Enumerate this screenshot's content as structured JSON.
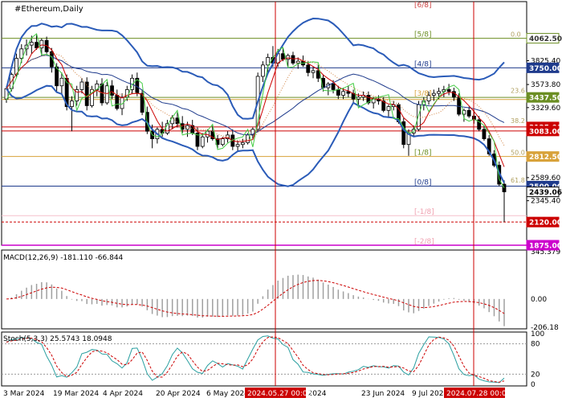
{
  "chart_data": {
    "type": "candlestick",
    "title": "#Ethereum,Daily",
    "price_axis": {
      "ticks": [
        "3825.40",
        "3573.80",
        "3329.60",
        "2589.60",
        "2345.40"
      ],
      "ylim": [
        1875,
        4450
      ]
    },
    "price_boxes": [
      {
        "label": "4062.50",
        "value": 4062.5,
        "bg": "#ffffff",
        "fg": "#333333",
        "border": "#6b8e23"
      },
      {
        "label": "3750.00",
        "value": 3750,
        "bg": "#1f3b8c",
        "fg": "#ffffff"
      },
      {
        "label": "3437.50",
        "value": 3437.5,
        "bg": "#6b8e23",
        "fg": "#ffffff"
      },
      {
        "label": "3125.00",
        "value": 3125,
        "bg": "#cc0000",
        "fg": "#ffffff"
      },
      {
        "label": "3083.00",
        "value": 3083,
        "bg": "#cc0000",
        "fg": "#ffffff"
      },
      {
        "label": "2812.50",
        "value": 2812.5,
        "bg": "#d8a23a",
        "fg": "#ffffff"
      },
      {
        "label": "2500.00",
        "value": 2500,
        "bg": "#1f3b8c",
        "fg": "#ffffff"
      },
      {
        "label": "2439.06",
        "value": 2439.06,
        "bg": "#ffffff",
        "fg": "#000000",
        "border": "#000000"
      },
      {
        "label": "2120.00",
        "value": 2120,
        "bg": "#cc0000",
        "fg": "#ffffff"
      },
      {
        "label": "1875.00",
        "value": 1875,
        "bg": "#cc00cc",
        "fg": "#ffffff"
      }
    ],
    "murrey_labels": [
      {
        "label": "[5/8]",
        "value": 4062.5,
        "color": "#6b8e23"
      },
      {
        "label": "[4/8]",
        "value": 3750,
        "color": "#1f3b8c"
      },
      {
        "label": "[3/8]",
        "value": 3437.5,
        "color": "#d8a23a"
      },
      {
        "label": "[1/8]",
        "value": 2812.5,
        "color": "#6b8e23"
      },
      {
        "label": "[0/8]",
        "value": 2500,
        "color": "#1f3b8c"
      },
      {
        "label": "[-1/8]",
        "value": 2187.5,
        "color": "#f0a0b0"
      },
      {
        "label": "[-2/8]",
        "value": 1875,
        "color": "#f0a0b0"
      },
      {
        "label": "[6/8]",
        "value": 4375,
        "color": "#cc4444"
      }
    ],
    "fib_labels": [
      {
        "label": "0.0",
        "value": 4062.5
      },
      {
        "label": "23.6",
        "value": 3470
      },
      {
        "label": "50.0",
        "value": 2812.5
      },
      {
        "label": "61.8",
        "value": 2520
      },
      {
        "label": "38.2",
        "value": 3150
      }
    ],
    "price_levels": [
      {
        "value": 4062.5,
        "color": "#6b8e23",
        "style": "solid"
      },
      {
        "value": 3750,
        "color": "#1f3b8c",
        "style": "solid"
      },
      {
        "value": 3437.5,
        "color": "#6b8e23",
        "style": "solid"
      },
      {
        "value": 3415,
        "color": "#d8a23a",
        "style": "solid"
      },
      {
        "value": 3125,
        "color": "#cc0000",
        "style": "solid"
      },
      {
        "value": 3083,
        "color": "#cc0000",
        "style": "solid"
      },
      {
        "value": 2812.5,
        "color": "#d8a23a",
        "style": "solid"
      },
      {
        "value": 2500,
        "color": "#1f3b8c",
        "style": "solid"
      },
      {
        "value": 2187.5,
        "color": "#f5c0cc",
        "style": "solid"
      },
      {
        "value": 2120,
        "color": "#cc0000",
        "style": "dashed"
      },
      {
        "value": 1875,
        "color": "#cc00cc",
        "style": "solid"
      }
    ],
    "x_labels": [
      "3 Mar 2024",
      "19 Mar 2024",
      "4 Apr 2024",
      "20 Apr 2024",
      "6 May 2024",
      "7 Jun 2024",
      "23 Jun 2024",
      "9 Jul 2024"
    ],
    "x_highlight": [
      "2024.05.27 00:00",
      "2024.07.28 00:00"
    ],
    "candles": [
      [
        3420,
        3560,
        3380,
        3530
      ],
      [
        3530,
        3700,
        3500,
        3680
      ],
      [
        3680,
        3900,
        3650,
        3850
      ],
      [
        3850,
        4000,
        3800,
        3950
      ],
      [
        3950,
        4050,
        3880,
        3990
      ],
      [
        3990,
        4090,
        3900,
        4020
      ],
      [
        4020,
        4100,
        3940,
        3960
      ],
      [
        3960,
        4060,
        3880,
        4040
      ],
      [
        4040,
        4080,
        3900,
        3920
      ],
      [
        3920,
        3960,
        3700,
        3760
      ],
      [
        3760,
        3800,
        3500,
        3560
      ],
      [
        3560,
        3700,
        3480,
        3640
      ],
      [
        3640,
        3680,
        3300,
        3340
      ],
      [
        3340,
        3450,
        3080,
        3400
      ],
      [
        3400,
        3560,
        3350,
        3520
      ],
      [
        3520,
        3640,
        3480,
        3600
      ],
      [
        3600,
        3650,
        3300,
        3350
      ],
      [
        3350,
        3560,
        3330,
        3520
      ],
      [
        3520,
        3620,
        3450,
        3580
      ],
      [
        3580,
        3640,
        3350,
        3380
      ],
      [
        3380,
        3600,
        3360,
        3560
      ],
      [
        3560,
        3620,
        3420,
        3460
      ],
      [
        3460,
        3520,
        3300,
        3320
      ],
      [
        3320,
        3480,
        3250,
        3440
      ],
      [
        3440,
        3560,
        3400,
        3520
      ],
      [
        3520,
        3680,
        3480,
        3640
      ],
      [
        3640,
        3700,
        3450,
        3480
      ],
      [
        3480,
        3520,
        3250,
        3280
      ],
      [
        3280,
        3340,
        3050,
        3080
      ],
      [
        3080,
        3150,
        2900,
        3000
      ],
      [
        3000,
        3120,
        2950,
        3100
      ],
      [
        3100,
        3180,
        3020,
        3060
      ],
      [
        3060,
        3200,
        3040,
        3160
      ],
      [
        3160,
        3250,
        3100,
        3220
      ],
      [
        3220,
        3280,
        3120,
        3160
      ],
      [
        3160,
        3240,
        3060,
        3100
      ],
      [
        3100,
        3180,
        3020,
        3140
      ],
      [
        3140,
        3200,
        3040,
        3060
      ],
      [
        3060,
        3120,
        2880,
        2920
      ],
      [
        2920,
        3060,
        2900,
        3020
      ],
      [
        3020,
        3100,
        2960,
        3080
      ],
      [
        3080,
        3140,
        2980,
        3000
      ],
      [
        3000,
        3040,
        2900,
        2940
      ],
      [
        2940,
        3020,
        2920,
        3000
      ],
      [
        3000,
        3080,
        2960,
        3040
      ],
      [
        3040,
        3100,
        2880,
        2920
      ],
      [
        2920,
        2980,
        2860,
        2940
      ],
      [
        2940,
        3000,
        2900,
        2960
      ],
      [
        2960,
        3060,
        2940,
        3040
      ],
      [
        3040,
        3120,
        3000,
        3100
      ],
      [
        3100,
        3700,
        3080,
        3660
      ],
      [
        3660,
        3820,
        3600,
        3780
      ],
      [
        3780,
        3900,
        3700,
        3860
      ],
      [
        3860,
        3980,
        3760,
        3800
      ],
      [
        3800,
        3950,
        3760,
        3900
      ],
      [
        3900,
        3960,
        3820,
        3840
      ],
      [
        3840,
        3900,
        3760,
        3880
      ],
      [
        3880,
        3920,
        3780,
        3800
      ],
      [
        3800,
        3860,
        3740,
        3820
      ],
      [
        3820,
        3880,
        3760,
        3780
      ],
      [
        3780,
        3820,
        3660,
        3700
      ],
      [
        3700,
        3760,
        3640,
        3720
      ],
      [
        3720,
        3780,
        3600,
        3640
      ],
      [
        3640,
        3680,
        3500,
        3540
      ],
      [
        3540,
        3600,
        3460,
        3580
      ],
      [
        3580,
        3620,
        3480,
        3520
      ],
      [
        3520,
        3560,
        3420,
        3460
      ],
      [
        3460,
        3540,
        3420,
        3500
      ],
      [
        3500,
        3560,
        3440,
        3480
      ],
      [
        3480,
        3520,
        3380,
        3420
      ],
      [
        3420,
        3480,
        3360,
        3440
      ],
      [
        3440,
        3500,
        3400,
        3460
      ],
      [
        3460,
        3500,
        3360,
        3380
      ],
      [
        3380,
        3440,
        3320,
        3420
      ],
      [
        3420,
        3460,
        3360,
        3400
      ],
      [
        3400,
        3440,
        3280,
        3300
      ],
      [
        3300,
        3360,
        3220,
        3340
      ],
      [
        3340,
        3400,
        3300,
        3360
      ],
      [
        3360,
        3380,
        3160,
        3180
      ],
      [
        3180,
        3220,
        2900,
        2940
      ],
      [
        2940,
        3100,
        2820,
        3060
      ],
      [
        3060,
        3140,
        3020,
        3100
      ],
      [
        3100,
        3400,
        3080,
        3360
      ],
      [
        3360,
        3440,
        3300,
        3400
      ],
      [
        3400,
        3500,
        3360,
        3460
      ],
      [
        3460,
        3520,
        3400,
        3480
      ],
      [
        3480,
        3540,
        3420,
        3500
      ],
      [
        3500,
        3560,
        3440,
        3520
      ],
      [
        3520,
        3580,
        3460,
        3500
      ],
      [
        3500,
        3540,
        3400,
        3440
      ],
      [
        3440,
        3480,
        3240,
        3260
      ],
      [
        3260,
        3320,
        3180,
        3300
      ],
      [
        3300,
        3340,
        3220,
        3240
      ],
      [
        3240,
        3300,
        3160,
        3200
      ],
      [
        3200,
        3240,
        3080,
        3100
      ],
      [
        3100,
        3140,
        2980,
        3000
      ],
      [
        3000,
        3040,
        2820,
        2840
      ],
      [
        2840,
        2880,
        2700,
        2720
      ],
      [
        2720,
        2760,
        2500,
        2520
      ],
      [
        2520,
        2560,
        2120,
        2439
      ]
    ],
    "indicators": {
      "macd": {
        "label": "MACD(12,26,9) -181.110 -66.844",
        "axis": [
          "345.379",
          "0.00",
          "-206.18"
        ],
        "range": [
          -206.18,
          345.379
        ]
      },
      "stoch": {
        "label": "Stoch(5,3,3) 25.5743 18.0948",
        "axis": [
          "100",
          "80",
          "20",
          "0"
        ],
        "range": [
          0,
          100
        ]
      }
    }
  }
}
